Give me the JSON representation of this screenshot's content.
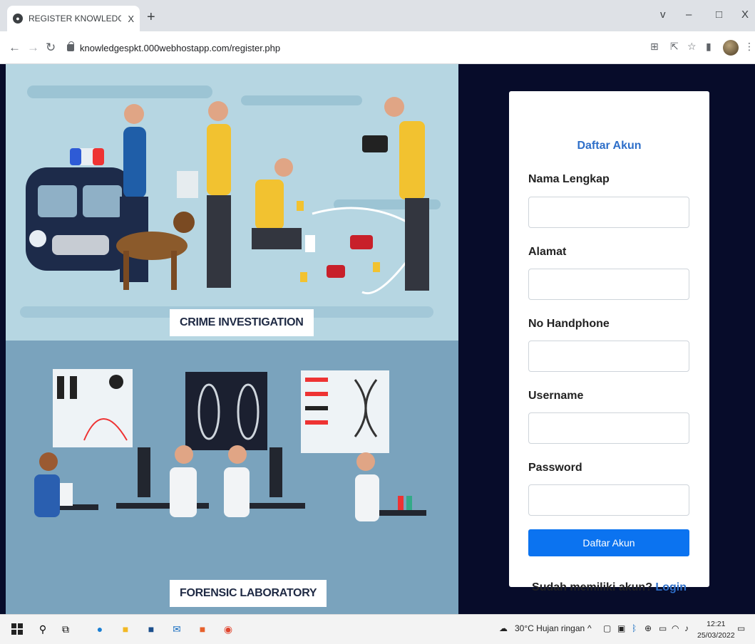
{
  "browser": {
    "tab_title": "REGISTER KNOWLEDGE MANAGE",
    "tab_close": "X",
    "new_tab": "+",
    "win_chevron": "v",
    "win_min": "–",
    "win_max": "□",
    "win_close": "X",
    "url": "knowledgespkt.000webhostapp.com/register.php"
  },
  "illustration": {
    "top_label": "CRIME INVESTIGATION",
    "bottom_label": "FORENSIC LABORATORY"
  },
  "form": {
    "title": "Daftar Akun",
    "fields": [
      {
        "label": "Nama Lengkap",
        "value": ""
      },
      {
        "label": "Alamat",
        "value": ""
      },
      {
        "label": "No Handphone",
        "value": ""
      },
      {
        "label": "Username",
        "value": ""
      },
      {
        "label": "Password",
        "value": ""
      }
    ],
    "submit_label": "Daftar Akun",
    "footer_text": "Sudah memiliki akun?",
    "login_link": "Login",
    "accent_color": "#2e6fc9",
    "button_color": "#0b73f0"
  },
  "taskbar": {
    "weather": "30°C  Hujan ringan",
    "time": "12:21",
    "date": "25/03/2022"
  }
}
